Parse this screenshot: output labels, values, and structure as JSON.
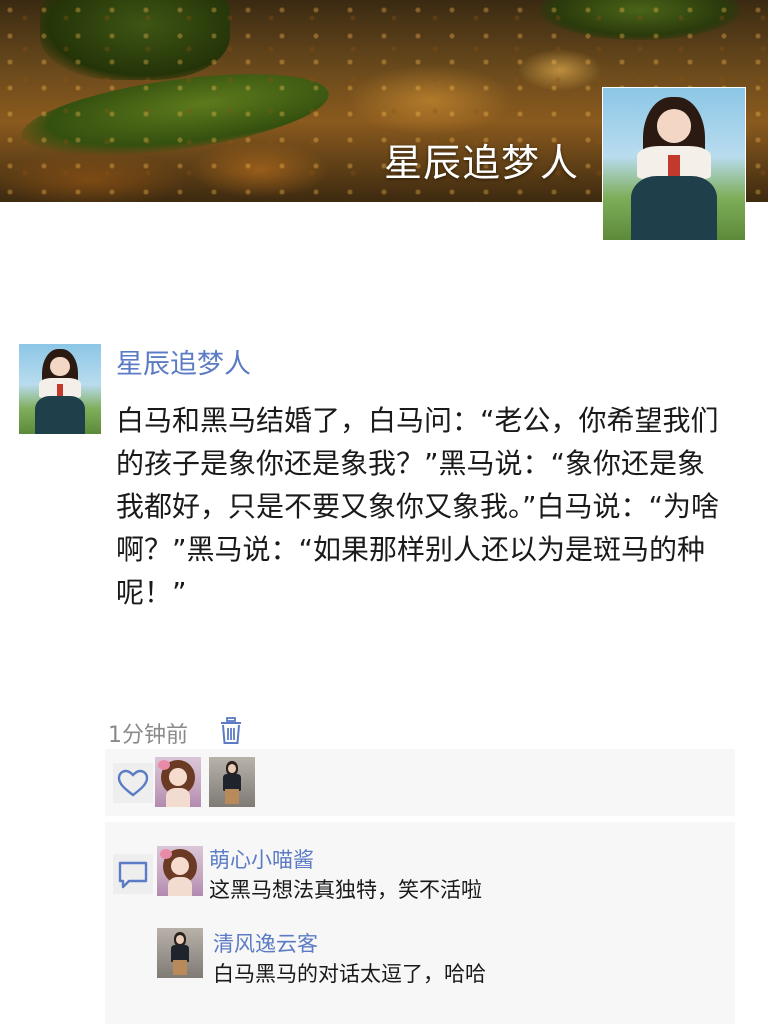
{
  "header": {
    "cover_image": "forest-floor-moss-autumn-leaves",
    "profile_name": "星辰追梦人",
    "profile_avatar": "woman-in-hanbok-avatar"
  },
  "post": {
    "author_name": "星辰追梦人",
    "author_avatar": "woman-in-hanbok-avatar",
    "text": "白马和黑马结婚了，白马问：“老公，你希望我们的孩子是象你还是象我？”黑马说：“象你还是象我都好，只是不要又象你又象我。”白马说：“为啥啊？”黑马说：“如果那样别人还以为是斑马的种呢！”",
    "time": "1分钟前",
    "delete_icon": "trash-icon"
  },
  "likes": {
    "icon": "heart-icon",
    "users": [
      {
        "avatar": "anime-girl-avatar"
      },
      {
        "avatar": "street-fashion-avatar"
      }
    ]
  },
  "comments": {
    "icon": "comment-bubble-icon",
    "items": [
      {
        "name": "萌心小喵酱",
        "text": "这黑马想法真独特，笑不活啦",
        "avatar": "anime-girl-avatar"
      },
      {
        "name": "清风逸云客",
        "text": "白马黑马的对话太逗了，哈哈",
        "avatar": "street-fashion-avatar"
      }
    ]
  },
  "colors": {
    "link_blue": "#5b7cc4",
    "panel_bg": "#f7f7f7",
    "text": "#1a1a1a",
    "meta_gray": "#8a8a8a"
  }
}
